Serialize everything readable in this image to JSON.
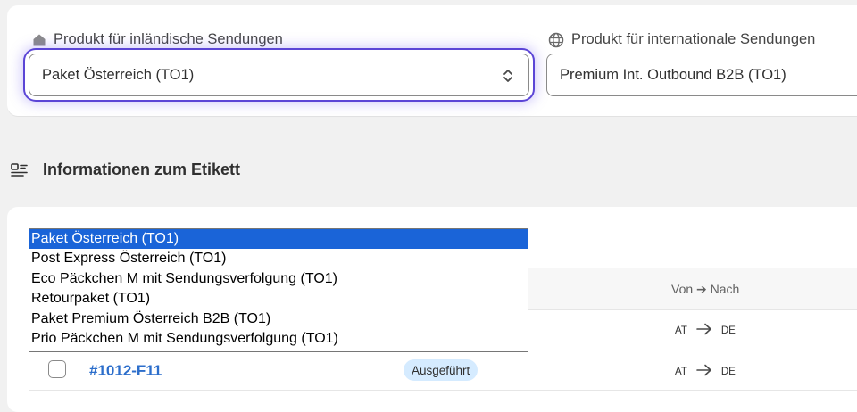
{
  "domestic": {
    "label": "Produkt für inländische Sendungen",
    "icon": "home-icon",
    "selected": "Paket Österreich (TO1)",
    "options": [
      "Paket Österreich (TO1)",
      "Post Express Österreich (TO1)",
      "Eco Päckchen M mit Sendungsverfolgung (TO1)",
      "Retourpaket (TO1)",
      "Paket Premium Österreich B2B (TO1)",
      "Prio Päckchen M mit Sendungsverfolgung (TO1)"
    ]
  },
  "international": {
    "label": "Produkt für internationale Sendungen",
    "icon": "globe-icon",
    "selected": "Premium Int. Outbound B2B (TO1)"
  },
  "section": {
    "title": "Informationen zum Etikett",
    "icon": "label-info-icon"
  },
  "table": {
    "col_route": "Von ➔ Nach",
    "rows": [
      {
        "order": "",
        "status": "",
        "from": "AT",
        "to": "DE"
      },
      {
        "order": "#1012-F11",
        "status": "Ausgeführt",
        "from": "AT",
        "to": "DE"
      }
    ]
  },
  "colors": {
    "focus_ring": "#5b45d6",
    "link": "#2c6ecb",
    "selected_option": "#1a64d8",
    "badge_bg": "#d5ebff"
  }
}
